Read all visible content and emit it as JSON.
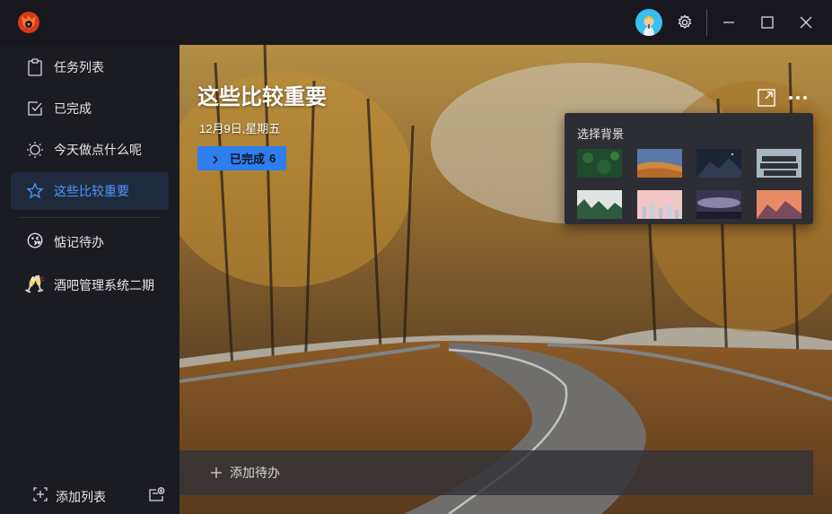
{
  "titlebar": {
    "logo_icon": "fox-logo-icon",
    "avatar_icon": "user-avatar-icon",
    "settings_icon": "gear-icon",
    "minimize_icon": "minimize-icon",
    "maximize_icon": "maximize-icon",
    "close_icon": "close-icon"
  },
  "sidebar": {
    "items": [
      {
        "label": "任务列表",
        "icon": "clipboard-icon"
      },
      {
        "label": "已完成",
        "icon": "check-square-icon"
      },
      {
        "label": "今天做点什么呢",
        "icon": "sun-icon"
      },
      {
        "label": "这些比较重要",
        "icon": "star-icon",
        "active": true
      }
    ],
    "lists": [
      {
        "label": "惦记待办",
        "emoji": "😘"
      },
      {
        "label": "酒吧管理系统二期",
        "emoji": "🥂"
      }
    ],
    "add_list_label": "添加列表",
    "add_group_icon": "add-group-icon"
  },
  "main": {
    "title": "这些比较重要",
    "date": "12月9日,星期五",
    "done_button": {
      "label": "已完成",
      "count": "6"
    },
    "add_task_placeholder": "添加待办"
  },
  "background_picker": {
    "title": "选择背景",
    "thumbnails": [
      "forest-aerial",
      "desert-dunes",
      "night-mountains",
      "modern-building",
      "misty-forest",
      "pink-city",
      "purple-clouds",
      "sunset-mountains"
    ]
  },
  "colors": {
    "accent": "#2f7ef0",
    "active_label": "#4f96ff",
    "sidebar_bg": "#1b1b22",
    "active_item_bg": "#1f2b3d"
  }
}
